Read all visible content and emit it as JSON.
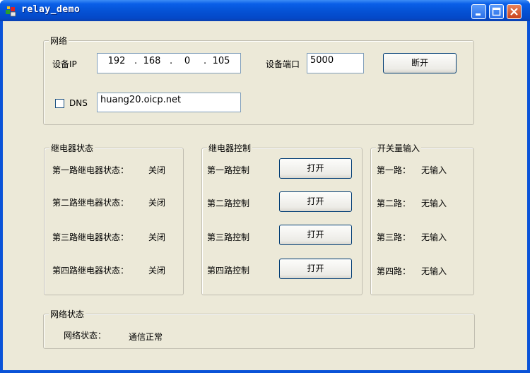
{
  "window": {
    "title": "relay_demo"
  },
  "network": {
    "group_label": "网络",
    "ip_label": "设备IP",
    "ip": [
      "192",
      "168",
      "0",
      "105"
    ],
    "port_label": "设备端口",
    "port": "5000",
    "disconnect_label": "断开",
    "dns_label": "DNS",
    "dns_checked": false,
    "dns_host": "huang20.oicp.net"
  },
  "relay_status": {
    "group_label": "继电器状态",
    "items": [
      {
        "label": "第一路继电器状态：",
        "value": "关闭"
      },
      {
        "label": "第二路继电器状态：",
        "value": "关闭"
      },
      {
        "label": "第三路继电器状态：",
        "value": "关闭"
      },
      {
        "label": "第四路继电器状态：",
        "value": "关闭"
      }
    ]
  },
  "relay_control": {
    "group_label": "继电器控制",
    "items": [
      {
        "label": "第一路控制",
        "button": "打开"
      },
      {
        "label": "第二路控制",
        "button": "打开"
      },
      {
        "label": "第三路控制",
        "button": "打开"
      },
      {
        "label": "第四路控制",
        "button": "打开"
      }
    ]
  },
  "switch_input": {
    "group_label": "开关量输入",
    "items": [
      {
        "label": "第一路：",
        "value": "无输入"
      },
      {
        "label": "第二路：",
        "value": "无输入"
      },
      {
        "label": "第三路：",
        "value": "无输入"
      },
      {
        "label": "第四路：",
        "value": "无输入"
      }
    ]
  },
  "net_status": {
    "group_label": "网络状态",
    "label": "网络状态：",
    "value": "通信正常"
  },
  "icons": {
    "app": "relay-app-icon",
    "minimize": "minimize-icon",
    "maximize": "maximize-icon",
    "close": "close-icon"
  }
}
